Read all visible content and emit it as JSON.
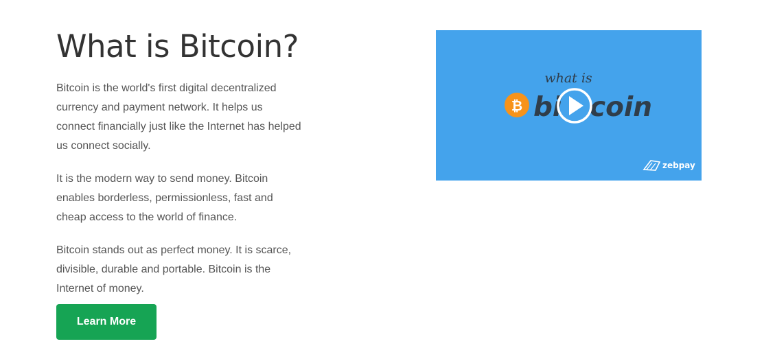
{
  "section": {
    "title": "What is Bitcoin?",
    "paragraphs": [
      "Bitcoin is the world's first digital decentralized currency and payment network. It helps us connect financially just like the Internet has helped us connect socially.",
      "It is the modern way to send money. Bitcoin enables borderless, permissionless, fast and cheap access to the world of finance.",
      "Bitcoin stands out as perfect money. It is scarce, divisible, durable and portable. Bitcoin is the Internet of money."
    ],
    "cta_label": "Learn More"
  },
  "video": {
    "thumbnail_small_text": "what is",
    "thumbnail_brand_prefix": "bi",
    "thumbnail_brand_suffix": "coin",
    "bitcoin_symbol": "₿",
    "watermark": "zebpay",
    "play_icon": "play-icon",
    "logo_icon": "bitcoin-logo-icon",
    "colors": {
      "background": "#44a3ec",
      "bitcoin_orange": "#f7931a",
      "brand_text": "#2f3d4a"
    }
  },
  "colors": {
    "cta_background": "#16a454",
    "heading": "#333333",
    "body_text": "#555555"
  }
}
